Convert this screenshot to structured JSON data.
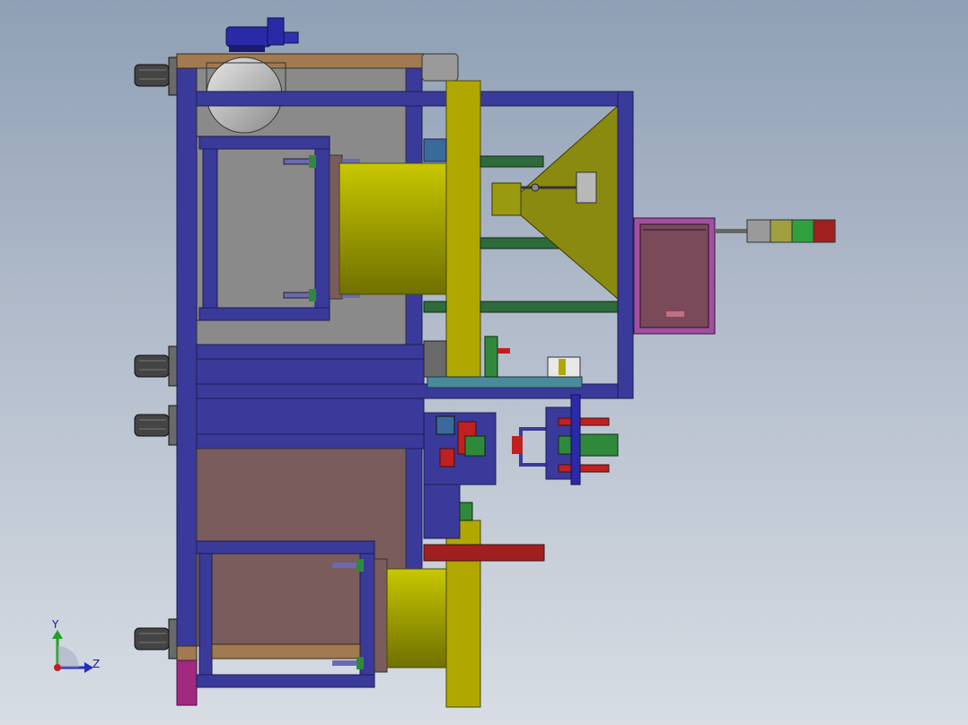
{
  "viewport": {
    "background_top": "#8fa0b5",
    "background_bottom": "#d8dde4"
  },
  "triad": {
    "y_label": "Y",
    "z_label": "Z",
    "y_color": "#20a020",
    "z_color": "#2030c0",
    "origin_color": "#c02020"
  },
  "colors": {
    "frame": "#3a3a9a",
    "frame_edge": "#1c1c55",
    "panel_grey": "#8a8a8a",
    "panel_brown": "#7a5c5c",
    "cylinder": "#a8a800",
    "hopper": "#8a8a10",
    "plate": "#b0a800",
    "rail_green": "#2e6b3a",
    "control_box": "#7a4a5a",
    "control_border": "#a050a0",
    "caster": "#444444",
    "motor": "#2a2aa8",
    "accent_red": "#c02020",
    "wood": "#a07a50"
  },
  "signal_tower": {
    "segments": [
      "#9a9a9a",
      "#a0a040",
      "#30a040",
      "#a02020"
    ]
  }
}
